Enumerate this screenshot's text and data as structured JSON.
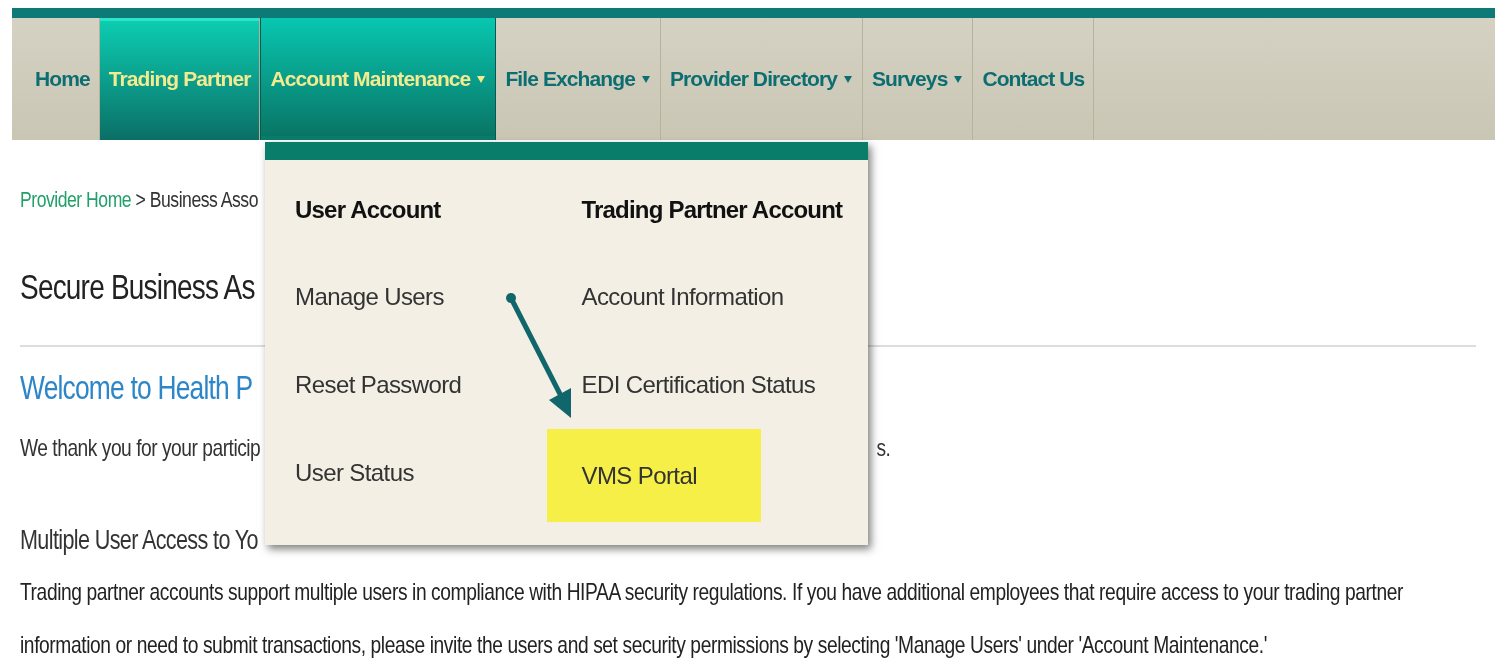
{
  "nav": [
    {
      "label": "Home",
      "selected": false,
      "expanded": false,
      "has_dropdown": false
    },
    {
      "label": "Trading Partner",
      "selected": true,
      "expanded": false,
      "has_dropdown": false
    },
    {
      "label": "Account Maintenance",
      "selected": false,
      "expanded": true,
      "has_dropdown": true
    },
    {
      "label": "File Exchange",
      "selected": false,
      "expanded": false,
      "has_dropdown": true
    },
    {
      "label": "Provider Directory",
      "selected": false,
      "expanded": false,
      "has_dropdown": true
    },
    {
      "label": "Surveys",
      "selected": false,
      "expanded": false,
      "has_dropdown": true
    },
    {
      "label": "Contact Us",
      "selected": false,
      "expanded": false,
      "has_dropdown": false
    }
  ],
  "breadcrumb": {
    "link": "Provider Home",
    "rest": "> Business Asso"
  },
  "page_title": "Secure Business As",
  "welcome": "Welcome to Health P",
  "thanks": {
    "start": "We thank you for your particip",
    "end": "s."
  },
  "section_heading": "Multiple User Access to Yo",
  "paragraph": "Trading partner accounts support multiple users in compliance with HIPAA security regulations. If you have additional employees that require access to your trading partner information or need to submit transactions, please invite the users and set security permissions by selecting 'Manage Users' under 'Account Maintenance.'",
  "dropdown": {
    "columns": [
      {
        "heading": "User Account",
        "items": [
          {
            "label": "Manage Users",
            "highlighted": false
          },
          {
            "label": "Reset Password",
            "highlighted": false
          },
          {
            "label": "User Status",
            "highlighted": false
          }
        ]
      },
      {
        "heading": "Trading Partner Account",
        "items": [
          {
            "label": "Account Information",
            "highlighted": false
          },
          {
            "label": "EDI Certification Status",
            "highlighted": false
          },
          {
            "label": "VMS Portal",
            "highlighted": true
          }
        ]
      }
    ]
  }
}
